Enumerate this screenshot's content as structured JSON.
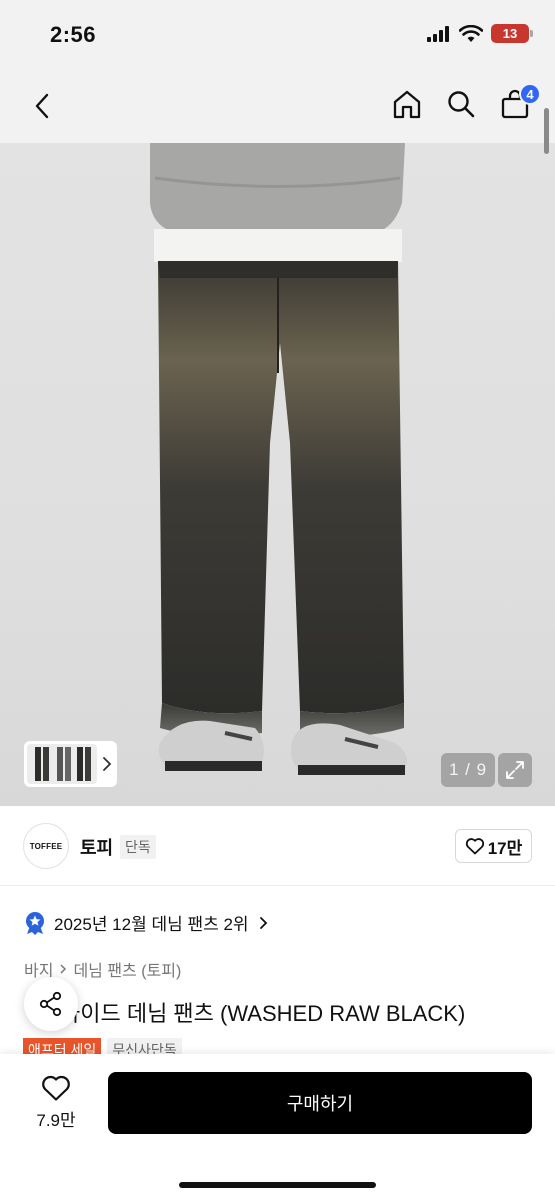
{
  "status_bar": {
    "time": "2:56",
    "battery": "13"
  },
  "nav": {
    "cart_count": "4"
  },
  "gallery": {
    "counter": "1 / 9"
  },
  "brand": {
    "logo_text": "TOFFEE",
    "name": "토피",
    "exclusive": "단독",
    "likes": "17만"
  },
  "ranking": {
    "text": "2025년 12월 데님 팬츠 2위"
  },
  "breadcrumb": [
    "바지",
    "데님 팬츠 (토피)"
  ],
  "product": {
    "title": "와이드 데님 팬츠 (WASHED RAW BLACK)"
  },
  "tags": [
    "애프터 세일",
    "무신사단독"
  ],
  "bottom": {
    "wish_count": "7.9만",
    "buy_label": "구매하기"
  },
  "colors": {
    "badge_blue": "#2f67f6",
    "sale_orange": "#e8552b",
    "battery_red": "#c8372d",
    "ranking_blue": "#2b63d8"
  }
}
